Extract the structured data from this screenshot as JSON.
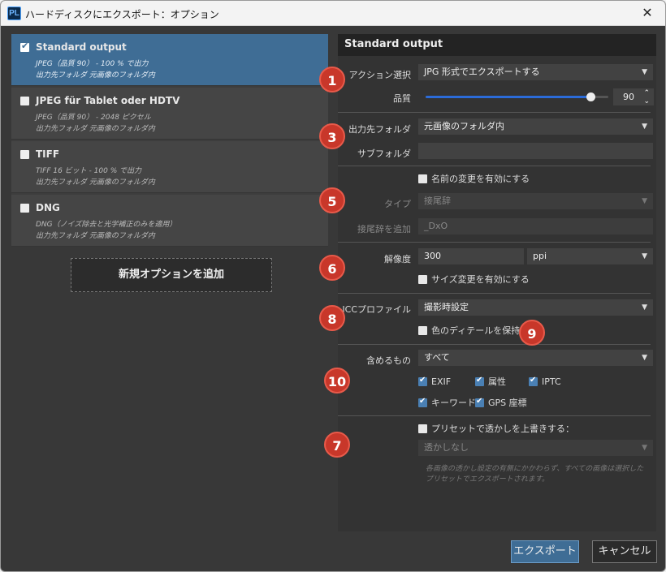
{
  "window": {
    "app_icon": "PL",
    "title": "ハードディスクにエクスポート：オプション",
    "close": "✕"
  },
  "presets": [
    {
      "name": "Standard output",
      "desc": "JPEG（品質 90） - 100 % で出力",
      "dest": "出力先フォルダ 元画像のフォルダ内",
      "checked": true
    },
    {
      "name": "JPEG für Tablet oder HDTV",
      "desc": "JPEG（品質 90） - 2048 ピクセル",
      "dest": "出力先フォルダ 元画像のフォルダ内",
      "checked": false
    },
    {
      "name": "TIFF",
      "desc": "TIFF 16 ビット - 100 % で出力",
      "dest": "出力先フォルダ 元画像のフォルダ内",
      "checked": false
    },
    {
      "name": "DNG",
      "desc": "DNG（ノイズ除去と光学補正のみを適用）",
      "dest": "出力先フォルダ 元画像のフォルダ内",
      "checked": false
    }
  ],
  "add_option_label": "新規オプションを追加",
  "panel": {
    "title": "Standard output",
    "action_label": "アクション選択",
    "action_value": "JPG 形式でエクスポートする",
    "quality_label": "品質",
    "quality_value": "90",
    "quality_fraction": 0.9,
    "dest_label": "出力先フォルダ",
    "dest_value": "元画像のフォルダ内",
    "subfolder_label": "サブフォルダ",
    "subfolder_value": "",
    "rename_label": "名前の変更を有効にする",
    "type_label": "タイプ",
    "type_value": "接尾辞",
    "suffix_label": "接尾辞を追加",
    "suffix_value": "_DxO",
    "resolution_label": "解像度",
    "resolution_value": "300",
    "resolution_unit": "ppi",
    "resize_label": "サイズ変更を有効にする",
    "icc_label": "ICCプロファイル",
    "icc_value": "撮影時設定",
    "color_detail_label": "色のディテールを保持",
    "include_label": "含めるもの",
    "include_value": "すべて",
    "meta": {
      "exif": "EXIF",
      "attr": "属性",
      "iptc": "IPTC",
      "keyword": "キーワード",
      "gps": "GPS 座標"
    },
    "watermark_label": "プリセットで透かしを上書きする：",
    "watermark_value": "透かしなし",
    "watermark_note": "各画像の透かし設定の有無にかかわらず、すべての画像は選択したプリセットでエクスポートされます。"
  },
  "badges": [
    "1",
    "3",
    "5",
    "6",
    "8",
    "9",
    "10",
    "7"
  ],
  "buttons": {
    "export": "エクスポート",
    "cancel": "キャンセル"
  },
  "colors": {
    "accent": "#3f6d95",
    "badge": "#c8372a",
    "slider": "#2b6bd9"
  }
}
